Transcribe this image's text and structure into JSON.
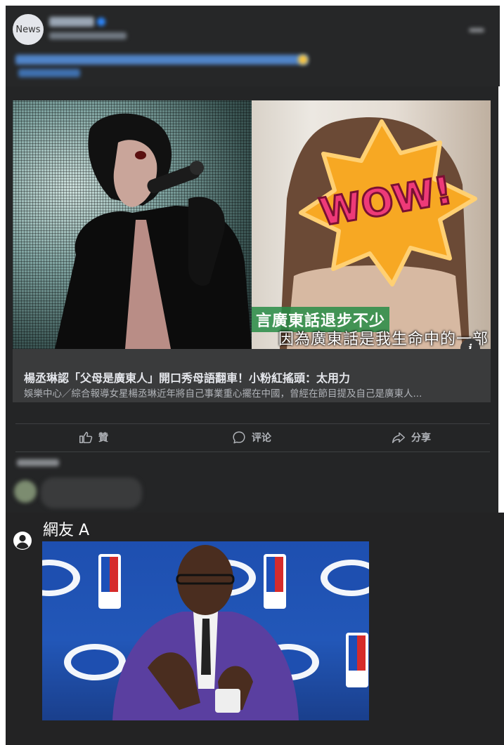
{
  "post": {
    "avatar_text": "News",
    "link_preview": {
      "title": "楊丞琳認「父母是廣東人」開口秀母語翻車！小粉紅搖頭：太用力",
      "description": "娛樂中心／綜合報導女星楊丞琳近年將自己事業重心擺在中國，曾經在節目提及自己是廣東人..."
    },
    "image_captions": {
      "wow": "WOW!",
      "line1": "言廣東話退步不少",
      "line2": "因為廣東話是我生命中的一部"
    },
    "info_icon_glyph": "i"
  },
  "actions": [
    {
      "label": "贊",
      "icon": "thumbs-up-icon"
    },
    {
      "label": "评论",
      "icon": "comment-icon"
    },
    {
      "label": "分享",
      "icon": "share-icon"
    }
  ],
  "reply": {
    "user_label": "網友 A"
  },
  "colors": {
    "panel_bg": "#242526",
    "link_box_bg": "#3a3b3c",
    "link_title": "#e4e6eb",
    "secondary_text": "#b0b3b8",
    "wow_yellow": "#f7a823",
    "wow_pink": "#ee3a78"
  }
}
